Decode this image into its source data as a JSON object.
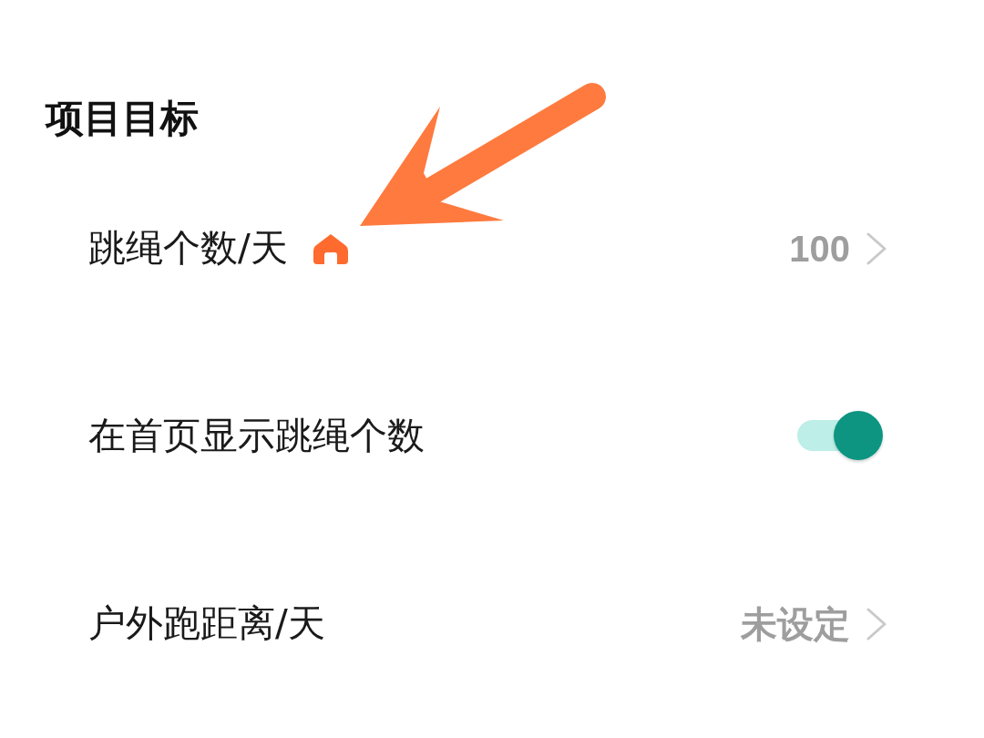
{
  "section": {
    "title": "项目目标"
  },
  "rows": [
    {
      "kind": "value",
      "label": "跳绳个数/天",
      "on_home": true,
      "value": "100"
    },
    {
      "kind": "toggle",
      "label": "在首页显示跳绳个数",
      "on_home": false,
      "on": true
    },
    {
      "kind": "value",
      "label": "户外跑距离/天",
      "on_home": false,
      "value": "未设定"
    }
  ],
  "annotation": {
    "kind": "arrow"
  }
}
